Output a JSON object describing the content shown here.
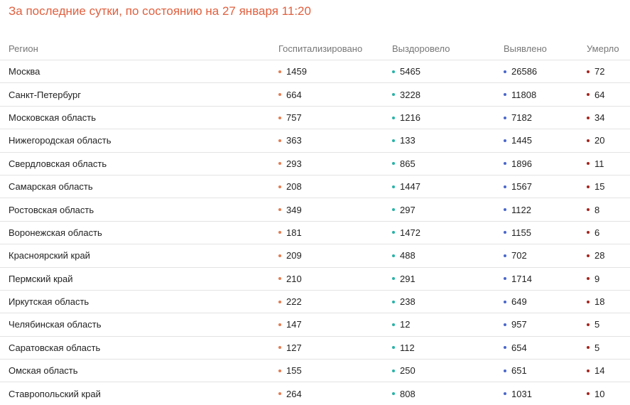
{
  "title": "За последние сутки, по состоянию на 27 января 11:20",
  "colors": {
    "title": "#e0603f",
    "hospitalized": "#e57c52",
    "recovered": "#27b3a8",
    "detected": "#4a67c9",
    "died": "#a3251e"
  },
  "columns": {
    "region": "Регион",
    "hospitalized": "Госпитализировано",
    "recovered": "Выздоровело",
    "detected": "Выявлено",
    "died": "Умерло"
  },
  "rows": [
    {
      "region": "Москва",
      "hospitalized": "1459",
      "recovered": "5465",
      "detected": "26586",
      "died": "72"
    },
    {
      "region": "Санкт-Петербург",
      "hospitalized": "664",
      "recovered": "3228",
      "detected": "11808",
      "died": "64"
    },
    {
      "region": "Московская область",
      "hospitalized": "757",
      "recovered": "1216",
      "detected": "7182",
      "died": "34"
    },
    {
      "region": "Нижегородская область",
      "hospitalized": "363",
      "recovered": "133",
      "detected": "1445",
      "died": "20"
    },
    {
      "region": "Свердловская область",
      "hospitalized": "293",
      "recovered": "865",
      "detected": "1896",
      "died": "11"
    },
    {
      "region": "Самарская область",
      "hospitalized": "208",
      "recovered": "1447",
      "detected": "1567",
      "died": "15"
    },
    {
      "region": "Ростовская область",
      "hospitalized": "349",
      "recovered": "297",
      "detected": "1122",
      "died": "8"
    },
    {
      "region": "Воронежская область",
      "hospitalized": "181",
      "recovered": "1472",
      "detected": "1155",
      "died": "6"
    },
    {
      "region": "Красноярский край",
      "hospitalized": "209",
      "recovered": "488",
      "detected": "702",
      "died": "28"
    },
    {
      "region": "Пермский край",
      "hospitalized": "210",
      "recovered": "291",
      "detected": "1714",
      "died": "9"
    },
    {
      "region": "Иркутская область",
      "hospitalized": "222",
      "recovered": "238",
      "detected": "649",
      "died": "18"
    },
    {
      "region": "Челябинская область",
      "hospitalized": "147",
      "recovered": "12",
      "detected": "957",
      "died": "5"
    },
    {
      "region": "Саратовская область",
      "hospitalized": "127",
      "recovered": "112",
      "detected": "654",
      "died": "5"
    },
    {
      "region": "Омская область",
      "hospitalized": "155",
      "recovered": "250",
      "detected": "651",
      "died": "14"
    },
    {
      "region": "Ставропольский край",
      "hospitalized": "264",
      "recovered": "808",
      "detected": "1031",
      "died": "10"
    }
  ]
}
